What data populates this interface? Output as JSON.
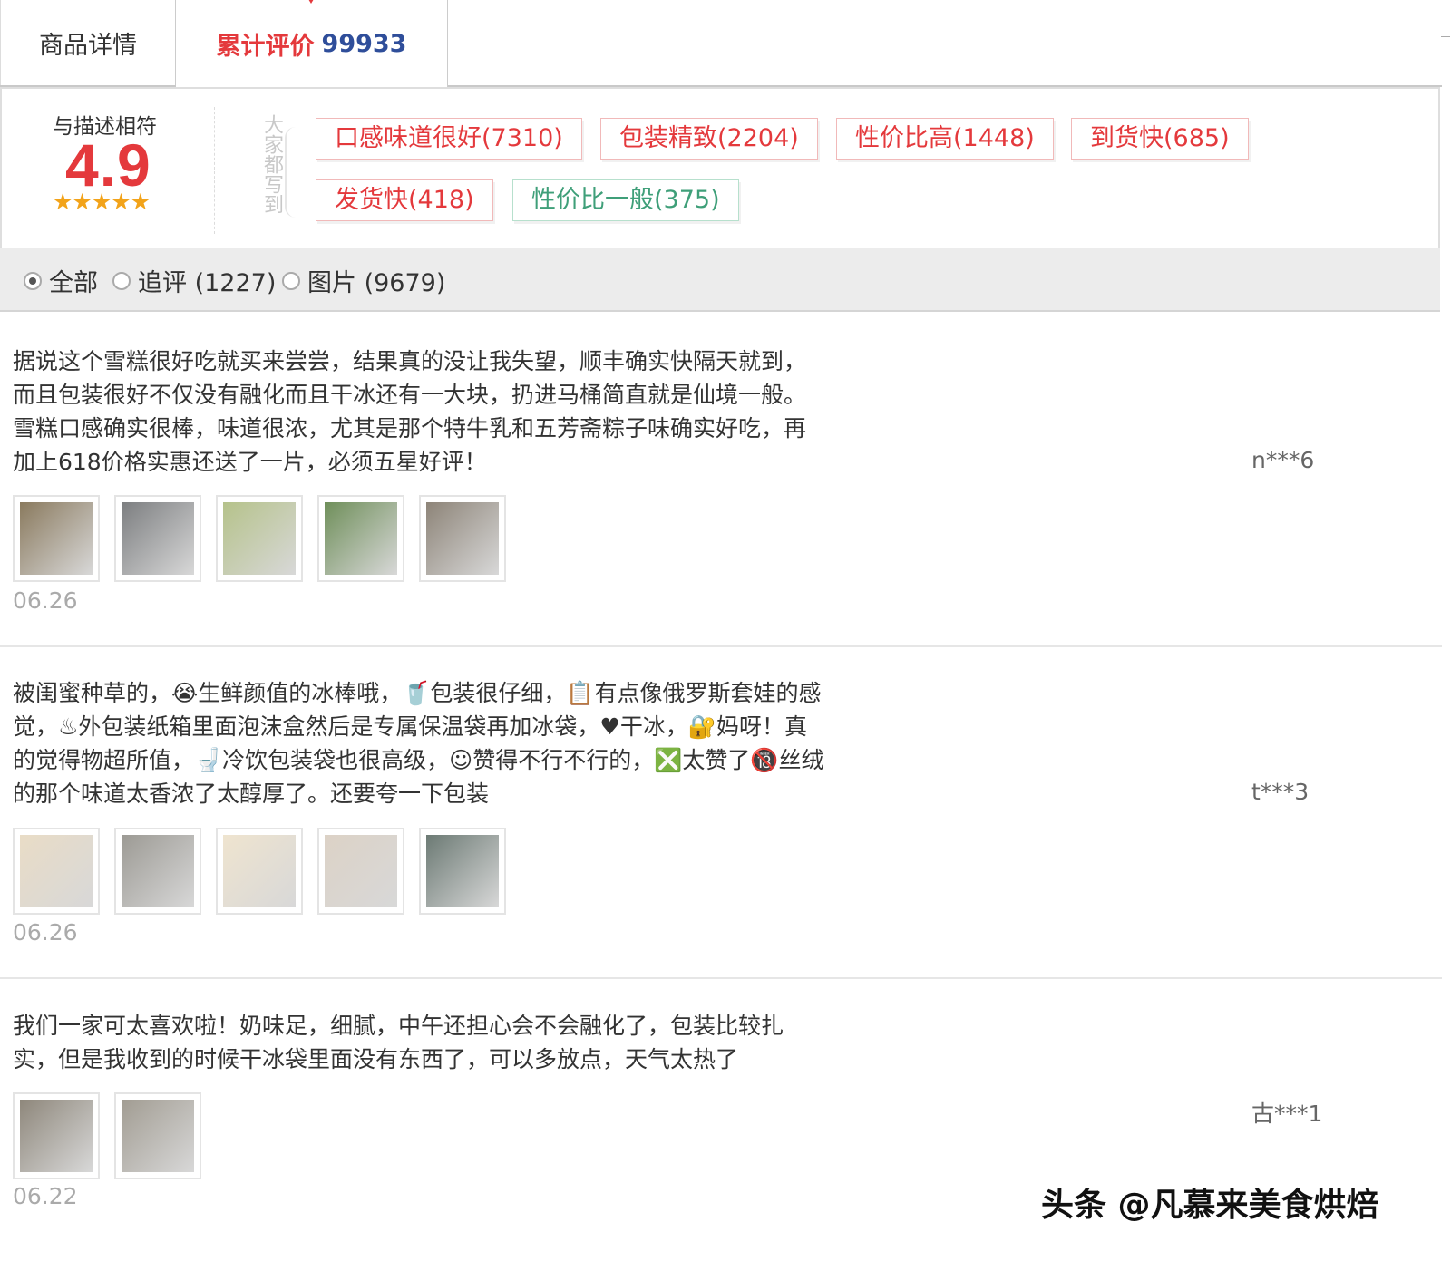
{
  "tabs": {
    "detail": "商品详情",
    "reviews_label": "累计评价",
    "reviews_count": "99933"
  },
  "summary": {
    "label": "与描述相符",
    "score": "4.9",
    "stars": "★★★★★",
    "everyone_wrote": "大家都写到",
    "tags": [
      {
        "text": "口感味道很好(7310)",
        "tone": "positive"
      },
      {
        "text": "包装精致(2204)",
        "tone": "positive"
      },
      {
        "text": "性价比高(1448)",
        "tone": "positive"
      },
      {
        "text": "到货快(685)",
        "tone": "positive"
      },
      {
        "text": "发货快(418)",
        "tone": "positive"
      },
      {
        "text": "性价比一般(375)",
        "tone": "neutral"
      }
    ]
  },
  "filters": [
    {
      "label": "全部",
      "selected": true
    },
    {
      "label": "追评 (1227)",
      "selected": false
    },
    {
      "label": "图片 (9679)",
      "selected": false
    }
  ],
  "reviews": [
    {
      "lines": [
        "据说这个雪糕很好吃就买来尝尝，结果真的没让我失望，顺丰确实快隔天就到，",
        "而且包装很好不仅没有融化而且干冰还有一大块，扔进马桶简直就是仙境一般。",
        "雪糕口感确实很棒，味道很浓，尤其是那个特牛乳和五芳斋粽子味确实好吃，再",
        "加上618价格实惠还送了一片，必须五星好评！"
      ],
      "user": "n***6",
      "date": "06.26",
      "photos": [
        "#8a7a5e",
        "#7c7e80",
        "#b5c28a",
        "#6f8f5a",
        "#8d8478"
      ]
    },
    {
      "lines": [
        "被闺蜜种草的，😭生鲜颜值的冰棒哦，🥤包装很仔细，📋有点像俄罗斯套娃的感",
        "觉，♨外包装纸箱里面泡沫盒然后是专属保温袋再加冰袋，♥干冰，🔐妈呀！真",
        "的觉得物超所值，🚽冷饮包装袋也很高级，☺赞得不行不行的，❎太赞了🔞丝绒",
        "的那个味道太香浓了太醇厚了。还要夸一下包装"
      ],
      "user": "t***3",
      "date": "06.26",
      "photos": [
        "#e9dcc6",
        "#9c9a94",
        "#efe4cf",
        "#dcd2c6",
        "#6c7a74"
      ]
    },
    {
      "lines": [
        "我们一家可太喜欢啦！奶味足，细腻，中午还担心会不会融化了，包装比较扎",
        "实，但是我收到的时候干冰袋里面没有东西了，可以多放点，天气太热了"
      ],
      "user": "古***1",
      "date": "06.22",
      "photos": [
        "#8e877b",
        "#a19c92"
      ]
    }
  ],
  "watermark": "头条 @凡慕来美食烘焙"
}
